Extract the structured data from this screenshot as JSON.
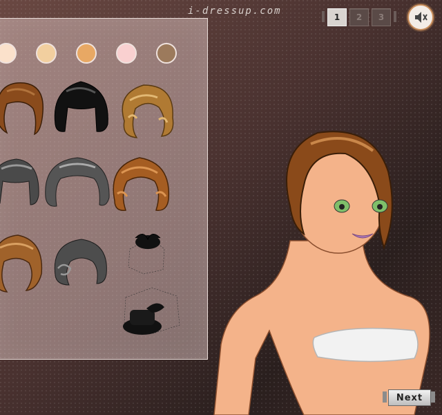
{
  "brand": "i-dressup.com",
  "pages": {
    "labels": [
      "1",
      "2",
      "3"
    ],
    "active": "1"
  },
  "sound": {
    "icon": "speaker-mute-icon"
  },
  "skin_tones": [
    "#fbe1cb",
    "#f2cf9f",
    "#e8a864",
    "#f9d0d0",
    "#9c7a5c"
  ],
  "hair_items": [
    {
      "name": "hair-auburn-flip",
      "color": "#8a4b1c"
    },
    {
      "name": "hair-black-bob-bangs",
      "color": "#111111"
    },
    {
      "name": "hair-golden-curls",
      "color": "#b07a33"
    },
    {
      "name": "hair-gray-bob-bangs",
      "color": "#4a4a4a"
    },
    {
      "name": "hair-gray-wavy",
      "color": "#555555"
    },
    {
      "name": "hair-copper-rolls",
      "color": "#a55d22"
    },
    {
      "name": "hair-auburn-side",
      "color": "#a0622a"
    },
    {
      "name": "hair-gray-curl",
      "color": "#4d4d4d"
    }
  ],
  "accessories": [
    {
      "name": "black-fascinator-hat"
    },
    {
      "name": "black-veil-pillbox-hat"
    }
  ],
  "next_button": {
    "label": "Next"
  }
}
